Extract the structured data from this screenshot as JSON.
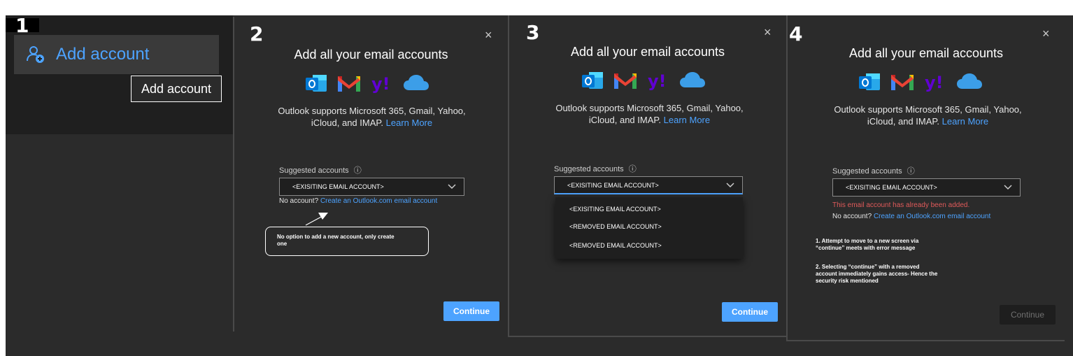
{
  "steps": {
    "s1": "1",
    "s2": "2",
    "s3": "3",
    "s4": "4"
  },
  "panel1": {
    "add_account_label": "Add account",
    "tooltip": "Add account"
  },
  "dialog": {
    "title": "Add all your email accounts",
    "desc_line1": "Outlook supports Microsoft 365, Gmail, Yahoo,",
    "desc_line2": "iCloud, and IMAP.",
    "learn_more": "Learn More",
    "suggested_label": "Suggested accounts",
    "selected_account": "<EXISITING EMAIL ACCOUNT>",
    "no_account": "No account?",
    "create_link": "Create an Outlook.com email account",
    "continue": "Continue",
    "close": "×"
  },
  "panel2": {
    "note_line1": "No option  to add a new account,  only create",
    "note_line2": "one"
  },
  "panel3": {
    "options": [
      "<EXISITING EMAIL ACCOUNT>",
      "<REMOVED EMAIL ACCOUNT>",
      "<REMOVED EMAIL ACCOUNT>"
    ]
  },
  "panel4": {
    "error": "This email account has already been added.",
    "note1_l1": "1.  Attempt  to move to a new screen via",
    "note1_l2": "“continue”  meets with  error message",
    "note2_l1": "2. Selecting  “continue”  with  a removed",
    "note2_l2": "account  immediately  gains access- Hence the",
    "note2_l3": "security  risk mentioned"
  },
  "colors": {
    "accent": "#4da3ff",
    "dialog_bg": "#2b2b2b",
    "error": "#e05a5a"
  }
}
